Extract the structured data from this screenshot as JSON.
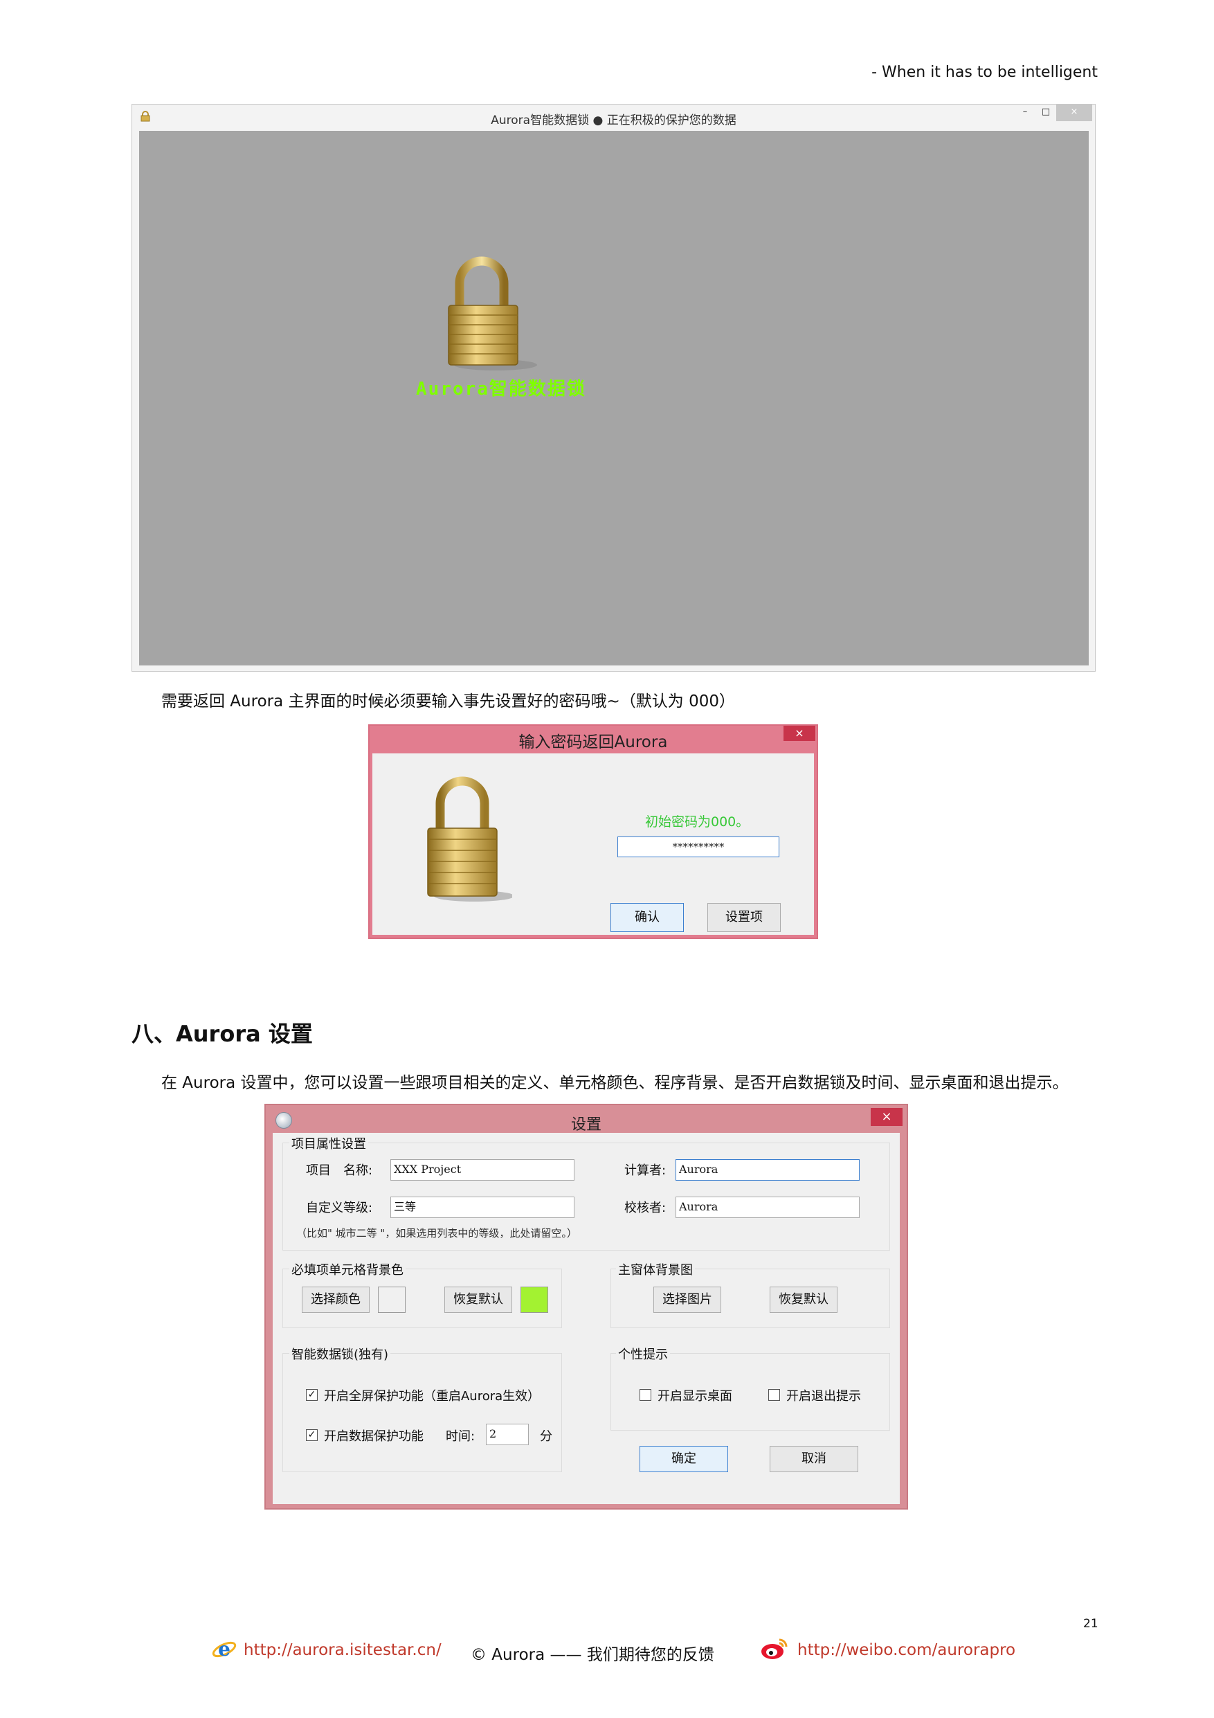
{
  "header": {
    "tagline": "- When it has to be intelligent"
  },
  "main_window": {
    "title": "Aurora智能数据锁 ● 正在积极的保护您的数据",
    "buttons": {
      "minimize": "–",
      "maximize": "□",
      "close": "×"
    },
    "lock_label": "Aurora智能数据锁",
    "lock_label_color": "#7fff00",
    "body_color": "#a5a5a5"
  },
  "paragraph1": "需要返回 Aurora 主界面的时候必须要输入事先设置好的密码哦~（默认为 000）",
  "password_dialog": {
    "title": "输入密码返回Aurora",
    "close": "×",
    "hint": "初始密码为000。",
    "password_value": "**********",
    "ok_button": "确认",
    "settings_button": "设置项",
    "title_color": "#e27d8f"
  },
  "section": {
    "heading": "八、Aurora 设置"
  },
  "paragraph2": "在 Aurora 设置中，您可以设置一些跟项目相关的定义、单元格颜色、程序背景、是否开启数据锁及时间、显示桌面和退出提示。",
  "settings_dialog": {
    "title": "设置",
    "close": "×",
    "title_color": "#d88f97",
    "project": {
      "group_label": "项目属性设置",
      "name_label": "项目　名称:",
      "name_value": "XXX Project",
      "level_label": "自定义等级:",
      "level_value": "三等",
      "calc_label": "计算者:",
      "calc_value": "Aurora",
      "check_label": "校核者:",
      "check_value": "Aurora",
      "note": "（比如\" 城市二等 \"，如果选用列表中的等级，此处请留空。）"
    },
    "cell_color": {
      "group_label": "必填项单元格背景色",
      "choose_button": "选择颜色",
      "reset_button": "恢复默认",
      "swatch_color": "#f0f0f0",
      "default_color": "#a3f231"
    },
    "main_bg": {
      "group_label": "主窗体背景图",
      "choose_button": "选择图片",
      "reset_button": "恢复默认"
    },
    "smart_lock": {
      "group_label": "智能数据锁(独有)",
      "fullscreen_label": "开启全屏保护功能（重启Aurora生效）",
      "fullscreen_checked": true,
      "data_protect_label": "开启数据保护功能",
      "data_protect_checked": true,
      "time_label": "时间:",
      "time_value": "2",
      "time_unit": "分"
    },
    "tips": {
      "group_label": "个性提示",
      "show_desktop_label": "开启显示桌面",
      "show_desktop_checked": false,
      "exit_tip_label": "开启退出提示",
      "exit_tip_checked": false
    },
    "ok_button": "确定",
    "cancel_button": "取消"
  },
  "footer": {
    "page_number": "21",
    "site_link": "http://aurora.isitestar.cn/",
    "copyright": "© Aurora —— 我们期待您的反馈",
    "weibo_link": "http://weibo.com/aurorapro",
    "ie_icon": "ie-icon",
    "weibo_icon": "weibo-icon"
  }
}
